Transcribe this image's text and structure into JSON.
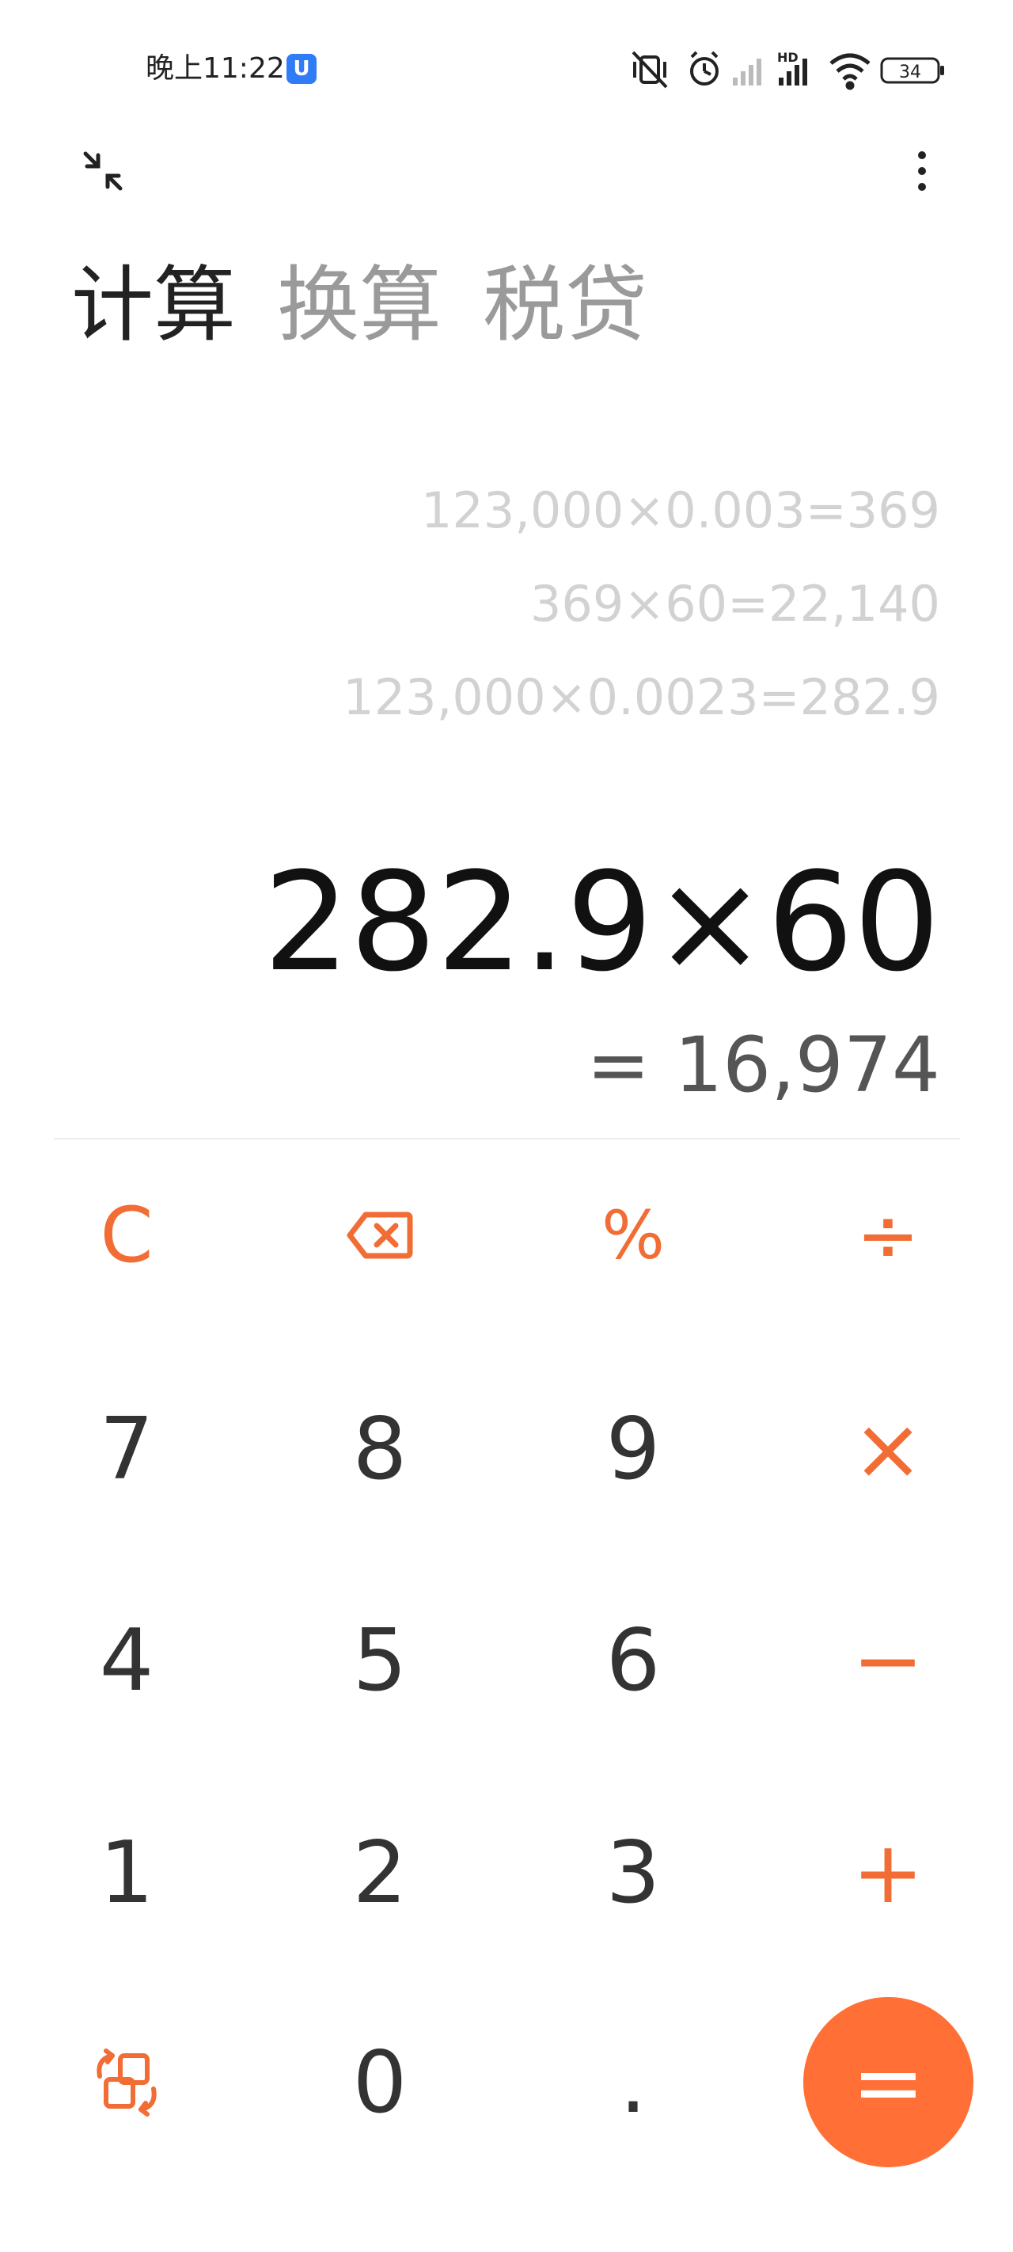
{
  "status_bar": {
    "time": "晚上11:22",
    "app_badge_icon": "shield-u-icon",
    "battery": "34",
    "icons": [
      "mute-vibrate-icon",
      "alarm-icon",
      "signal-icon",
      "hd-signal-icon",
      "wifi-icon",
      "battery-icon"
    ]
  },
  "top_bar": {
    "collapse_icon": "collapse-icon",
    "more_icon": "more-vertical-icon"
  },
  "tabs": [
    {
      "label": "计算",
      "active": true
    },
    {
      "label": "换算",
      "active": false
    },
    {
      "label": "税贷",
      "active": false
    }
  ],
  "history": [
    "123,000×0.003=369",
    "369×60=22,140",
    "123,000×0.0023=282.9"
  ],
  "display": {
    "expression": "282.9×60",
    "result": "= 16,974"
  },
  "keypad": {
    "row1": [
      "C",
      "backspace-icon",
      "%",
      "÷"
    ],
    "row2": [
      "7",
      "8",
      "9",
      "×"
    ],
    "row3": [
      "4",
      "5",
      "6",
      "−"
    ],
    "row4": [
      "1",
      "2",
      "3",
      "+"
    ],
    "row5": [
      "switch-mode-icon",
      "0",
      ".",
      "="
    ]
  },
  "colors": {
    "accent": "#f26d35",
    "equals_bg": "#ff6f36",
    "history_text": "#d2d2d2",
    "inactive_tab": "#9a9a9a"
  }
}
